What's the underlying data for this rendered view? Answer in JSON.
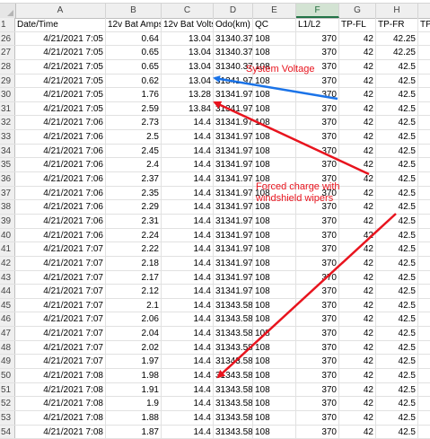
{
  "columns": [
    "A",
    "B",
    "C",
    "D",
    "E",
    "F",
    "G",
    "H"
  ],
  "selected_column": "F",
  "rows": [
    {
      "n": "1",
      "A": "Date/Time",
      "B": "12v Bat Amps",
      "C": "12v Bat Volts",
      "D": "Odo(km)",
      "E": "QC",
      "F": "L1/L2",
      "G": "TP-FL",
      "H": "TP-FR",
      "I": "TP-"
    },
    {
      "n": "26",
      "A": "4/21/2021 7:05",
      "B": "0.64",
      "C": "13.04",
      "D": "31340.37",
      "E": "108",
      "F": "370",
      "G": "42",
      "H": "42.25"
    },
    {
      "n": "27",
      "A": "4/21/2021 7:05",
      "B": "0.65",
      "C": "13.04",
      "D": "31340.37",
      "E": "108",
      "F": "370",
      "G": "42",
      "H": "42.25"
    },
    {
      "n": "28",
      "A": "4/21/2021 7:05",
      "B": "0.65",
      "C": "13.04",
      "D": "31340.37",
      "E": "108",
      "F": "370",
      "G": "42",
      "H": "42.5"
    },
    {
      "n": "29",
      "A": "4/21/2021 7:05",
      "B": "0.62",
      "C": "13.04",
      "D": "31341.97",
      "E": "108",
      "F": "370",
      "G": "42",
      "H": "42.5"
    },
    {
      "n": "30",
      "A": "4/21/2021 7:05",
      "B": "1.76",
      "C": "13.28",
      "D": "31341.97",
      "E": "108",
      "F": "370",
      "G": "42",
      "H": "42.5"
    },
    {
      "n": "31",
      "A": "4/21/2021 7:05",
      "B": "2.59",
      "C": "13.84",
      "D": "31341.97",
      "E": "108",
      "F": "370",
      "G": "42",
      "H": "42.5"
    },
    {
      "n": "32",
      "A": "4/21/2021 7:06",
      "B": "2.73",
      "C": "14.4",
      "D": "31341.97",
      "E": "108",
      "F": "370",
      "G": "42",
      "H": "42.5"
    },
    {
      "n": "33",
      "A": "4/21/2021 7:06",
      "B": "2.5",
      "C": "14.4",
      "D": "31341.97",
      "E": "108",
      "F": "370",
      "G": "42",
      "H": "42.5"
    },
    {
      "n": "34",
      "A": "4/21/2021 7:06",
      "B": "2.45",
      "C": "14.4",
      "D": "31341.97",
      "E": "108",
      "F": "370",
      "G": "42",
      "H": "42.5"
    },
    {
      "n": "35",
      "A": "4/21/2021 7:06",
      "B": "2.4",
      "C": "14.4",
      "D": "31341.97",
      "E": "108",
      "F": "370",
      "G": "42",
      "H": "42.5"
    },
    {
      "n": "36",
      "A": "4/21/2021 7:06",
      "B": "2.37",
      "C": "14.4",
      "D": "31341.97",
      "E": "108",
      "F": "370",
      "G": "42",
      "H": "42.5"
    },
    {
      "n": "37",
      "A": "4/21/2021 7:06",
      "B": "2.35",
      "C": "14.4",
      "D": "31341.97",
      "E": "108",
      "F": "370",
      "G": "42",
      "H": "42.5"
    },
    {
      "n": "38",
      "A": "4/21/2021 7:06",
      "B": "2.29",
      "C": "14.4",
      "D": "31341.97",
      "E": "108",
      "F": "370",
      "G": "42",
      "H": "42.5"
    },
    {
      "n": "39",
      "A": "4/21/2021 7:06",
      "B": "2.31",
      "C": "14.4",
      "D": "31341.97",
      "E": "108",
      "F": "370",
      "G": "42",
      "H": "42.5"
    },
    {
      "n": "40",
      "A": "4/21/2021 7:06",
      "B": "2.24",
      "C": "14.4",
      "D": "31341.97",
      "E": "108",
      "F": "370",
      "G": "42",
      "H": "42.5"
    },
    {
      "n": "41",
      "A": "4/21/2021 7:07",
      "B": "2.22",
      "C": "14.4",
      "D": "31341.97",
      "E": "108",
      "F": "370",
      "G": "42",
      "H": "42.5"
    },
    {
      "n": "42",
      "A": "4/21/2021 7:07",
      "B": "2.18",
      "C": "14.4",
      "D": "31341.97",
      "E": "108",
      "F": "370",
      "G": "42",
      "H": "42.5"
    },
    {
      "n": "43",
      "A": "4/21/2021 7:07",
      "B": "2.17",
      "C": "14.4",
      "D": "31341.97",
      "E": "108",
      "F": "370",
      "G": "42",
      "H": "42.5"
    },
    {
      "n": "44",
      "A": "4/21/2021 7:07",
      "B": "2.12",
      "C": "14.4",
      "D": "31341.97",
      "E": "108",
      "F": "370",
      "G": "42",
      "H": "42.5"
    },
    {
      "n": "45",
      "A": "4/21/2021 7:07",
      "B": "2.1",
      "C": "14.4",
      "D": "31343.58",
      "E": "108",
      "F": "370",
      "G": "42",
      "H": "42.5"
    },
    {
      "n": "46",
      "A": "4/21/2021 7:07",
      "B": "2.06",
      "C": "14.4",
      "D": "31343.58",
      "E": "108",
      "F": "370",
      "G": "42",
      "H": "42.5"
    },
    {
      "n": "47",
      "A": "4/21/2021 7:07",
      "B": "2.04",
      "C": "14.4",
      "D": "31343.58",
      "E": "108",
      "F": "370",
      "G": "42",
      "H": "42.5"
    },
    {
      "n": "48",
      "A": "4/21/2021 7:07",
      "B": "2.02",
      "C": "14.4",
      "D": "31343.58",
      "E": "108",
      "F": "370",
      "G": "42",
      "H": "42.5"
    },
    {
      "n": "49",
      "A": "4/21/2021 7:07",
      "B": "1.97",
      "C": "14.4",
      "D": "31343.58",
      "E": "108",
      "F": "370",
      "G": "42",
      "H": "42.5"
    },
    {
      "n": "50",
      "A": "4/21/2021 7:08",
      "B": "1.98",
      "C": "14.4",
      "D": "31343.58",
      "E": "108",
      "F": "370",
      "G": "42",
      "H": "42.5"
    },
    {
      "n": "51",
      "A": "4/21/2021 7:08",
      "B": "1.91",
      "C": "14.4",
      "D": "31343.58",
      "E": "108",
      "F": "370",
      "G": "42",
      "H": "42.5"
    },
    {
      "n": "52",
      "A": "4/21/2021 7:08",
      "B": "1.9",
      "C": "14.4",
      "D": "31343.58",
      "E": "108",
      "F": "370",
      "G": "42",
      "H": "42.5"
    },
    {
      "n": "53",
      "A": "4/21/2021 7:08",
      "B": "1.88",
      "C": "14.4",
      "D": "31343.58",
      "E": "108",
      "F": "370",
      "G": "42",
      "H": "42.5"
    },
    {
      "n": "54",
      "A": "4/21/2021 7:08",
      "B": "1.87",
      "C": "14.4",
      "D": "31343.58",
      "E": "108",
      "F": "370",
      "G": "42",
      "H": "42.5"
    }
  ],
  "annotations": {
    "system_voltage": "System Voltage",
    "forced_charge_line1": "Forced charge with",
    "forced_charge_line2": "windshield wipers"
  },
  "colors": {
    "annotation_red": "#e8141e",
    "annotation_blue": "#1a73e8",
    "header_selected": "#217346"
  }
}
